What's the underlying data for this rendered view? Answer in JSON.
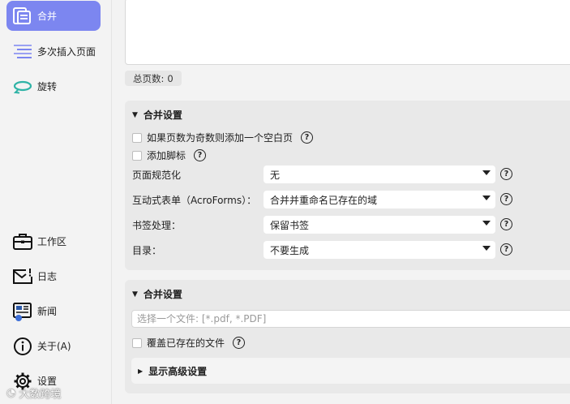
{
  "sidebar": {
    "items": [
      {
        "label": "合并",
        "icon": "merge-pages-icon",
        "active": true
      },
      {
        "label": "多次插入页面",
        "icon": "insert-lines-icon",
        "active": false
      },
      {
        "label": "旋转",
        "icon": "rotate-icon",
        "active": false
      },
      {
        "label": "工作区",
        "icon": "briefcase-icon",
        "active": false
      },
      {
        "label": "日志",
        "icon": "mail-log-icon",
        "active": false
      },
      {
        "label": "新闻",
        "icon": "news-icon",
        "active": false
      },
      {
        "label": "关于(A)",
        "icon": "info-icon",
        "active": false
      },
      {
        "label": "设置",
        "icon": "gear-icon",
        "active": false
      }
    ],
    "watermark": "大数跨境"
  },
  "main": {
    "page_count": {
      "label": "总页数:",
      "value": "0"
    },
    "merge_settings": {
      "title": "合并设置",
      "checkboxes": [
        {
          "label": "如果页数为奇数则添加一个空白页",
          "checked": false
        },
        {
          "label": "添加脚标",
          "checked": false
        }
      ],
      "fields": [
        {
          "label": "页面规范化",
          "value": "无"
        },
        {
          "label": "互动式表单（AcroForms）：",
          "value": "合并并重命名已存在的域"
        },
        {
          "label": "书签处理：",
          "value": "保留书签"
        },
        {
          "label": "目录：",
          "value": "不要生成"
        }
      ]
    },
    "output_settings": {
      "title": "合并设置",
      "file_placeholder": "选择一个文件: [*.pdf, *.PDF]",
      "overwrite_label": "覆盖已存在的文件",
      "advanced_label": "显示高级设置"
    }
  },
  "colors": {
    "accent": "#7c86f0",
    "icon_purple": "#7c86f0",
    "icon_teal": "#2fb3a6"
  }
}
